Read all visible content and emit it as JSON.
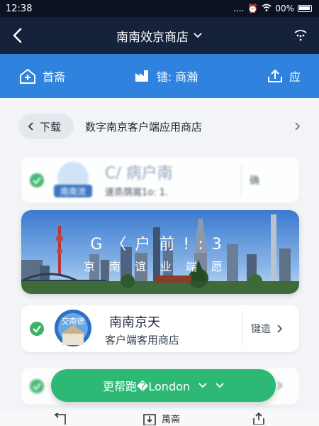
{
  "status_bar": {
    "time": "12:38",
    "signal": "....",
    "battery": "00%"
  },
  "nav": {
    "title": "南南效京商店"
  },
  "toolbar": {
    "items": [
      {
        "label": "首斋",
        "icon": "home-icon"
      },
      {
        "label": "镭: 商瀚",
        "icon": "factory-icon"
      },
      {
        "label": "应",
        "icon": "upload-icon"
      }
    ]
  },
  "breadcrumb": {
    "download_label": "下载",
    "text": "数字南京客户端应用商店"
  },
  "cards": {
    "first": {
      "name": "C/ 病户南",
      "logo_text": "南南流",
      "sub": "速烝荫嵩1o: 1.",
      "button": "确"
    },
    "banner": {
      "title": "G〈户前!:3",
      "subtitle": "京南谊业端愿"
    },
    "third": {
      "name": "南南京天",
      "sub": "客户端客用商店",
      "logo_text": "交南德",
      "button": "键造"
    }
  },
  "float_button": {
    "label": "更帮跑�London"
  },
  "bottom_bar": {
    "center_label": "萬斋"
  },
  "colors": {
    "nav_bg": "#16223a",
    "toolbar_bg": "#2f83de",
    "accent_green": "#2db975",
    "check_green": "#3cb36a"
  }
}
